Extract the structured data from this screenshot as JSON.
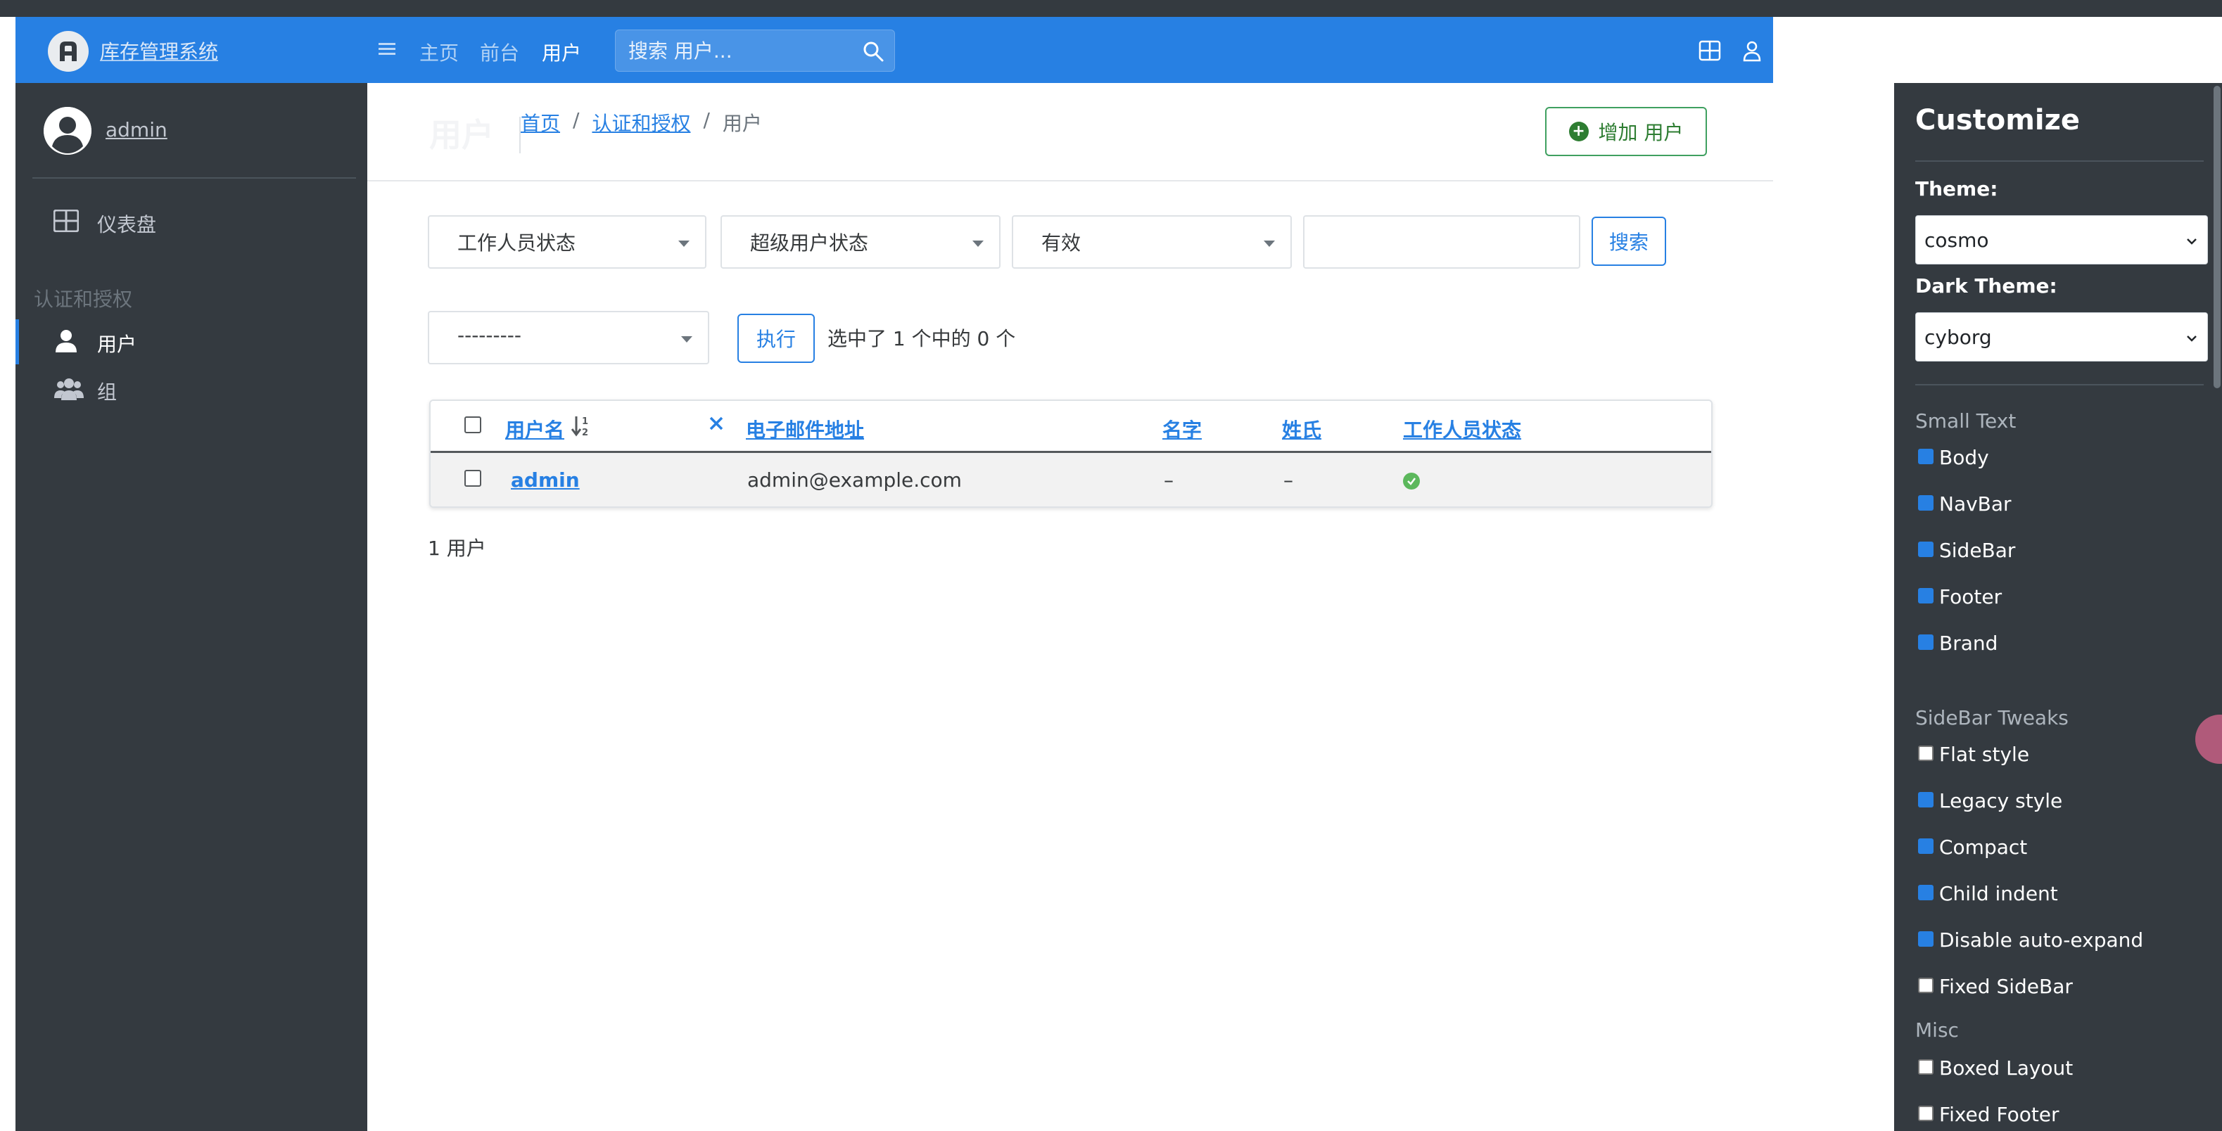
{
  "brand": {
    "name": "库存管理系统"
  },
  "user": {
    "name": "admin"
  },
  "sidebar": {
    "items": [
      {
        "label": "仪表盘"
      }
    ],
    "section_header": "认证和授权",
    "section_items": [
      {
        "label": "用户"
      },
      {
        "label": "组"
      }
    ]
  },
  "navbar": {
    "links": [
      "主页",
      "前台",
      "用户"
    ],
    "search_placeholder": "搜索 用户..."
  },
  "header": {
    "title": "用户",
    "breadcrumb": [
      "首页",
      "认证和授权",
      "用户"
    ],
    "add_button": "增加 用户"
  },
  "filters": {
    "staff_status": "工作人员状态",
    "superuser_status": "超级用户状态",
    "active": "有效",
    "search_button": "搜索"
  },
  "actions": {
    "select_value": "---------",
    "run_button": "执行",
    "selection_text": "选中了 1 个中的 0 个"
  },
  "table": {
    "columns": [
      "用户名",
      "电子邮件地址",
      "名字",
      "姓氏",
      "工作人员状态"
    ],
    "rows": [
      {
        "username": "admin",
        "email": "admin@example.com",
        "first_name": "–",
        "last_name": "–",
        "is_staff": true
      }
    ]
  },
  "result_count": "1 用户",
  "customize": {
    "title": "Customize",
    "theme_label": "Theme:",
    "theme_value": "cosmo",
    "dark_theme_label": "Dark Theme:",
    "dark_theme_value": "cyborg",
    "small_text_header": "Small Text",
    "small_text": [
      {
        "label": "Body",
        "checked": true
      },
      {
        "label": "NavBar",
        "checked": true
      },
      {
        "label": "SideBar",
        "checked": true
      },
      {
        "label": "Footer",
        "checked": true
      },
      {
        "label": "Brand",
        "checked": true
      }
    ],
    "sidebar_tweaks_header": "SideBar Tweaks",
    "sidebar_tweaks": [
      {
        "label": "Flat style",
        "checked": false
      },
      {
        "label": "Legacy style",
        "checked": true
      },
      {
        "label": "Compact",
        "checked": true
      },
      {
        "label": "Child indent",
        "checked": true
      },
      {
        "label": "Disable auto-expand",
        "checked": true
      },
      {
        "label": "Fixed SideBar",
        "checked": false
      }
    ],
    "misc_header": "Misc",
    "misc": [
      {
        "label": "Boxed Layout",
        "checked": false
      },
      {
        "label": "Fixed Footer",
        "checked": false
      }
    ]
  },
  "colors": {
    "primary": "#2780e3",
    "sidebar_bg": "#343a40",
    "success": "#5cb85c"
  }
}
